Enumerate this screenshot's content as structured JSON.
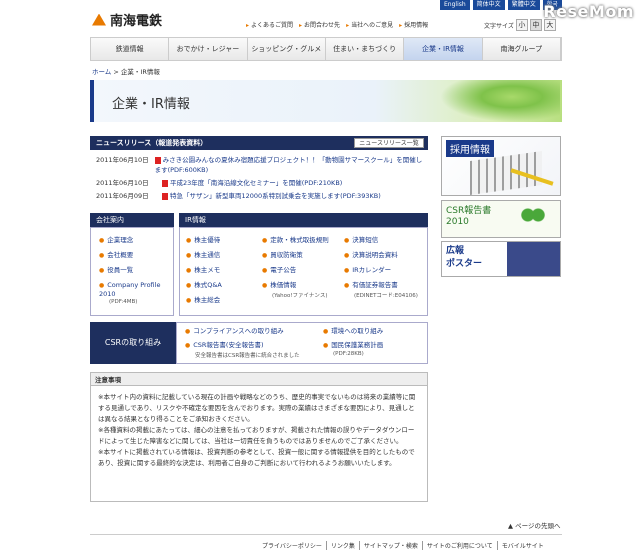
{
  "brand": {
    "logo_text": "南海電鉄",
    "watermark": "ReseMom"
  },
  "top_langs": [
    "English",
    "简体中文",
    "繁體中文",
    "한국"
  ],
  "utility_links": [
    "よくあるご質問",
    "お問合わせ先",
    "当社へのご意見",
    "採用情報"
  ],
  "font_size": {
    "label": "文字サイズ",
    "options": [
      "小",
      "中",
      "大"
    ]
  },
  "global_nav": [
    "鉄道情報",
    "おでかけ・レジャー",
    "ショッピング・グルメ",
    "住まい・まちづくり",
    "企業・IR情報",
    "南海グループ"
  ],
  "breadcrumb": {
    "home": "ホーム",
    "sep": " > ",
    "current": "企業・IR情報"
  },
  "page_title": "企業・IR情報",
  "news": {
    "heading": "ニュースリリース（報道発表資料）",
    "list_button": "ニュースリリース一覧",
    "items": [
      {
        "date": "2011年06月10日",
        "text": "みさき公園みんなの夏休み宿題応援プロジェクト！！「動物園サマースクール」を開催します(PDF:600KB)"
      },
      {
        "date": "2011年06月10日",
        "text": "平成23年度「南海沿線文化セミナー」を開催(PDF:210KB)"
      },
      {
        "date": "2011年06月09日",
        "text": "特急「サザン」新型車両12000系特別試乗会を実施します(PDF:393KB)"
      }
    ]
  },
  "company": {
    "heading": "会社案内",
    "items": [
      "企業理念",
      "会社概要",
      "役員一覧",
      "Company Profile 2010"
    ],
    "profile_note": "(PDF:4MB)"
  },
  "ir": {
    "heading": "IR情報",
    "col1": [
      "株主優待",
      "株主通信",
      "株主メモ",
      "株式Q&A",
      "株主総会"
    ],
    "col2": [
      "定款・株式取扱規則",
      "買収防衛策",
      "電子公告",
      "株価情報"
    ],
    "col2_note": "(Yahoo!ファイナンス)",
    "col3": [
      "決算短信",
      "決算説明会資料",
      "IRカレンダー",
      "有価証券報告書"
    ],
    "col3_note": "(EDINETコード:E04106)"
  },
  "csr": {
    "heading": "CSRの取り組み",
    "items": [
      "コンプライアンスへの取り組み",
      "環境への取り組み",
      "CSR報告書(安全報告書)",
      "国民保護業務計画"
    ],
    "report_note": "安全報告書はCSR報告書に統合されました",
    "plan_note": "(PDF:28KB)"
  },
  "notice": {
    "heading": "注意事項",
    "paragraphs": [
      "※本サイト内の資料に記載している現在の計画や戦略などのうち、歴史的事実でないものは将来の業績等に関する見通しであり、リスクや不確定な要因を含んでおります。実際の業績はさまざまな要因により、見通しとは異なる結果となり得ることをご承知おきください。",
      "※各種資料の掲載にあたっては、細心の注意を払っておりますが、掲載された情報の誤りやデータダウンロードによって生じた障害などに関しては、当社は一切責任を負うものではありませんのでご了承ください。",
      "※本サイトに掲載されている情報は、投資判断の参考として、投資一般に関する情報提供を目的としたものであり、投資に関する最終的な決定は、利用者ご自身のご判断において行われるようお願いいたします。"
    ]
  },
  "sidebar": {
    "recruit": "採用情報",
    "csr_report": [
      "CSR報告書",
      "2010"
    ],
    "poster": [
      "広報",
      "ポスター"
    ]
  },
  "page_top": "ページの先頭へ",
  "footer_links": [
    "プライバシーポリシー",
    "リンク集",
    "サイトマップ・検索",
    "サイトのご利用について",
    "モバイルサイト"
  ]
}
